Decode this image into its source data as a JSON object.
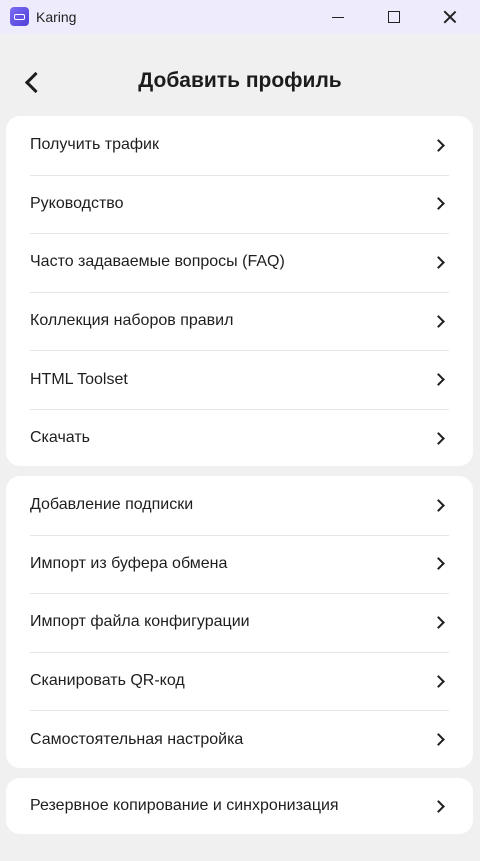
{
  "window": {
    "title": "Karing"
  },
  "header": {
    "title": "Добавить профиль"
  },
  "sections": [
    {
      "items": [
        {
          "label": "Получить трафик"
        },
        {
          "label": "Руководство"
        },
        {
          "label": "Часто задаваемые вопросы (FAQ)"
        },
        {
          "label": "Коллекция наборов правил"
        },
        {
          "label": "HTML Toolset"
        },
        {
          "label": "Скачать"
        }
      ]
    },
    {
      "items": [
        {
          "label": "Добавление подписки"
        },
        {
          "label": "Импорт из буфера обмена"
        },
        {
          "label": "Импорт файла конфигурации"
        },
        {
          "label": "Сканировать QR-код"
        },
        {
          "label": "Самостоятельная настройка"
        }
      ]
    },
    {
      "items": [
        {
          "label": "Резервное копирование и синхронизация"
        }
      ]
    }
  ],
  "colors": {
    "titlebar": "#eeecfc",
    "background": "#f0f0f0",
    "card": "#ffffff",
    "accent": "#6b5cf0"
  }
}
